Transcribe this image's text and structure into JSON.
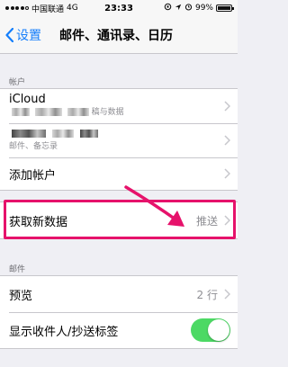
{
  "status_bar": {
    "carrier": "中国联通",
    "network": "4G",
    "time": "23:33",
    "battery": "99%"
  },
  "nav": {
    "back_label": "设置",
    "title": "邮件、通讯录、日历"
  },
  "accounts": {
    "header": "帐户",
    "items": [
      {
        "title": "iCloud",
        "subtitle": "稿与数据"
      },
      {
        "title": "",
        "subtitle": "邮件、备忘录"
      }
    ],
    "add_account_label": "添加帐户"
  },
  "fetch": {
    "label": "获取新数据",
    "value": "推送"
  },
  "mail": {
    "header": "邮件",
    "preview_label": "预览",
    "preview_value": "2 行",
    "show_to_cc_label": "显示收件人/抄送标签",
    "show_to_cc_on": true
  },
  "colors": {
    "accent": "#147efb",
    "highlight": "#e6126b",
    "toggle_on": "#4cd964"
  }
}
